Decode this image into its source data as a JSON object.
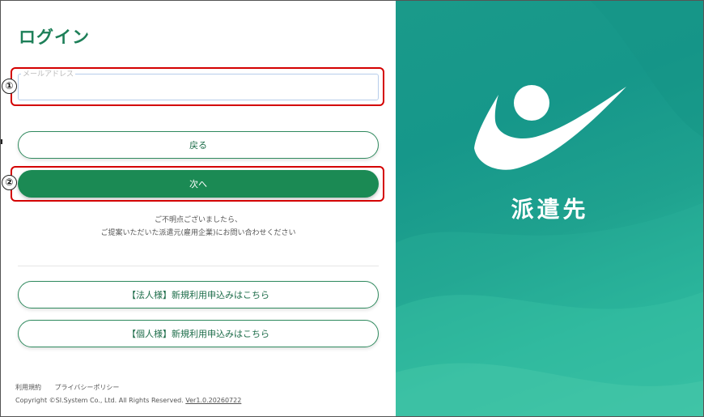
{
  "login": {
    "title": "ログイン",
    "email_label": "メールアドレス",
    "email_value": "",
    "back_button": "戻る",
    "next_button": "次へ",
    "note_line1": "ご不明点ございましたら、",
    "note_line2": "ご提案いただいた派遣元(雇用企業)にお問い合わせください",
    "corporate_signup": "【法人様】新規利用申込みはこちら",
    "individual_signup": "【個人様】新規利用申込みはこちら"
  },
  "annotations": {
    "marker1": "①",
    "marker2": "②",
    "color": "#d40000"
  },
  "footer": {
    "terms": "利用規約",
    "privacy": "プライバシーポリシー",
    "copyright": "Copyright ©SI.System Co., Ltd. All Rights Reserved.",
    "version": "Ver1.0.20260722"
  },
  "brand": {
    "name": "派遣先",
    "accent": "#1b8a54",
    "panel_color": "#1a9a8a"
  }
}
